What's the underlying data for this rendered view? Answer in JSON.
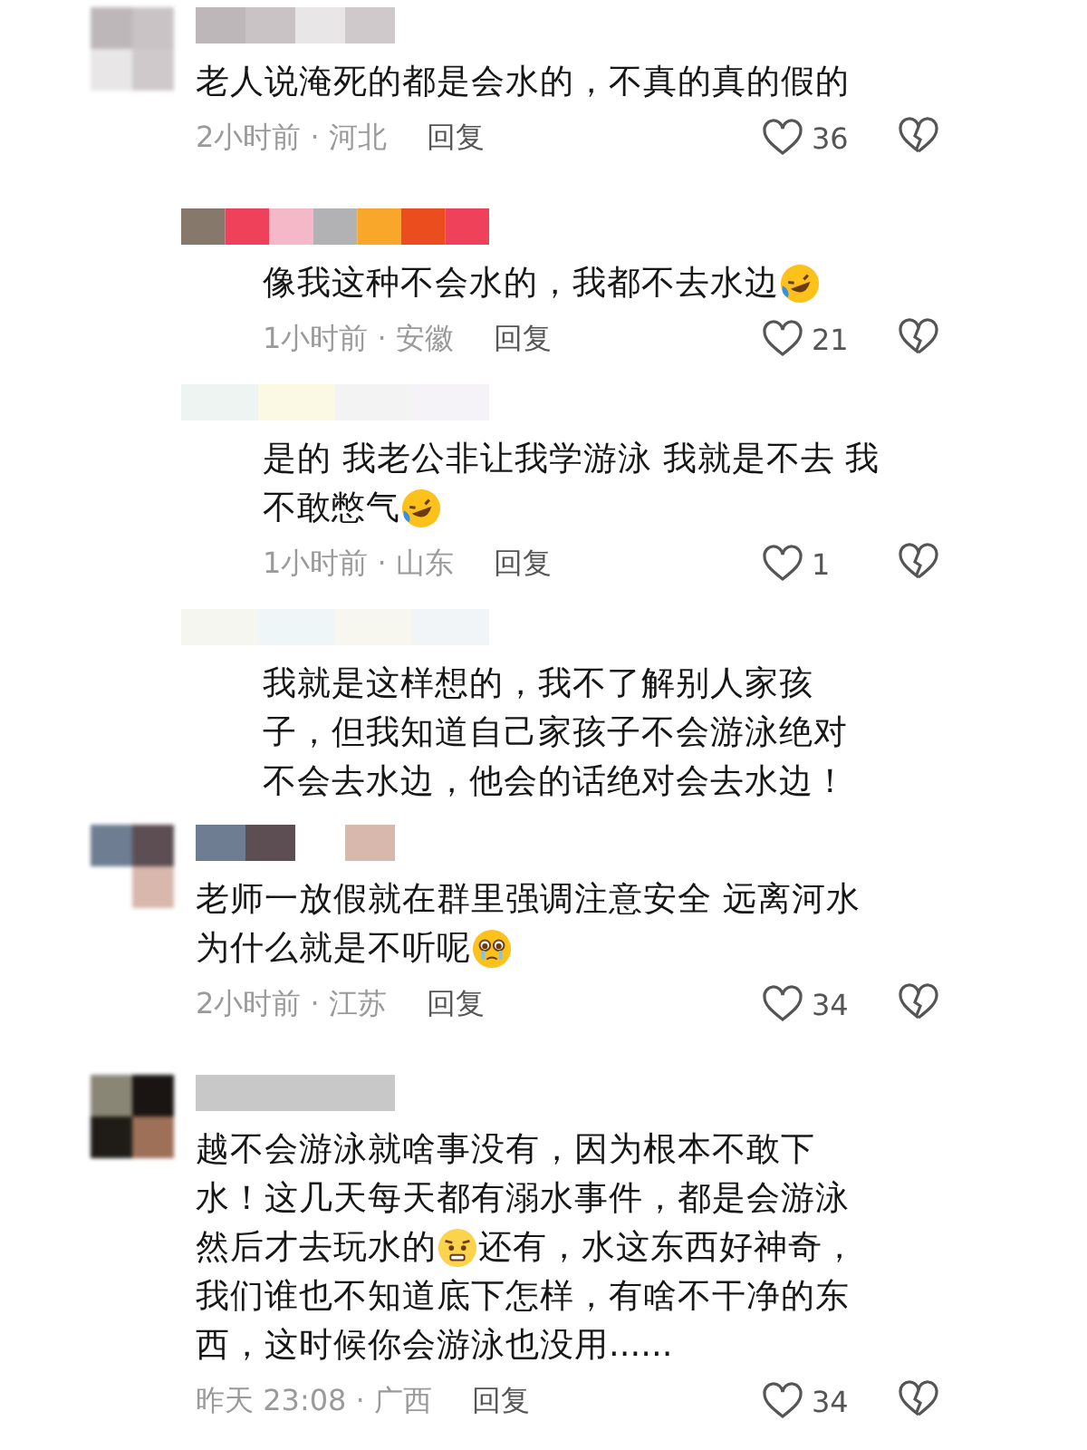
{
  "comments": [
    {
      "kind": "comment",
      "lines": [
        [
          {
            "kind": "text",
            "text": "老人说淹死的都是会水的，不真的真的假的"
          }
        ]
      ],
      "meta": {
        "time_place": "2小时前 · 河北",
        "reply": "回复",
        "likes": "36"
      }
    },
    {
      "kind": "reply",
      "lines": [
        [
          {
            "kind": "text",
            "text": "像我这种不会水的，我都不去水边"
          },
          {
            "kind": "laugh"
          }
        ]
      ],
      "meta": {
        "time_place": "1小时前 · 安徽",
        "reply": "回复",
        "likes": "21"
      }
    },
    {
      "kind": "reply",
      "lines": [
        [
          {
            "kind": "text",
            "text": "是的 我老公非让我学游泳 我就是不去 我"
          }
        ],
        [
          {
            "kind": "text",
            "text": "不敢憋气"
          },
          {
            "kind": "laugh"
          }
        ]
      ],
      "meta": {
        "time_place": "1小时前 · 山东",
        "reply": "回复",
        "likes": "1"
      }
    },
    {
      "kind": "reply",
      "lines": [
        [
          {
            "kind": "text",
            "text": "我就是这样想的，我不了解别人家孩"
          }
        ],
        [
          {
            "kind": "text",
            "text": "子，但我知道自己家孩子不会游泳绝对"
          }
        ],
        [
          {
            "kind": "text",
            "text": "不会去水边，他会的话绝对会去水边！"
          }
        ]
      ]
    },
    {
      "kind": "comment",
      "lines": [
        [
          {
            "kind": "text",
            "text": "老师一放假就在群里强调注意安全 远离河水"
          }
        ],
        [
          {
            "kind": "text",
            "text": "为什么就是不听呢"
          },
          {
            "kind": "plead"
          }
        ]
      ],
      "meta": {
        "time_place": "2小时前 · 江苏",
        "reply": "回复",
        "likes": "34"
      }
    },
    {
      "kind": "comment",
      "lines": [
        [
          {
            "kind": "text",
            "text": "越不会游泳就啥事没有，因为根本不敢下"
          }
        ],
        [
          {
            "kind": "text",
            "text": "水！这几天每天都有溺水事件，都是会游泳"
          }
        ],
        [
          {
            "kind": "text",
            "text": "然后才去玩水的"
          },
          {
            "kind": "worried"
          },
          {
            "kind": "text",
            "text": "还有，水这东西好神奇，"
          }
        ],
        [
          {
            "kind": "text",
            "text": "我们谁也不知道底下怎样，有啥不干净的东"
          }
        ],
        [
          {
            "kind": "text",
            "text": "西，这时候你会游泳也没用......"
          }
        ]
      ],
      "meta": {
        "time_place": "昨天 23:08 · 广西",
        "reply": "回复",
        "likes": "34"
      }
    }
  ]
}
